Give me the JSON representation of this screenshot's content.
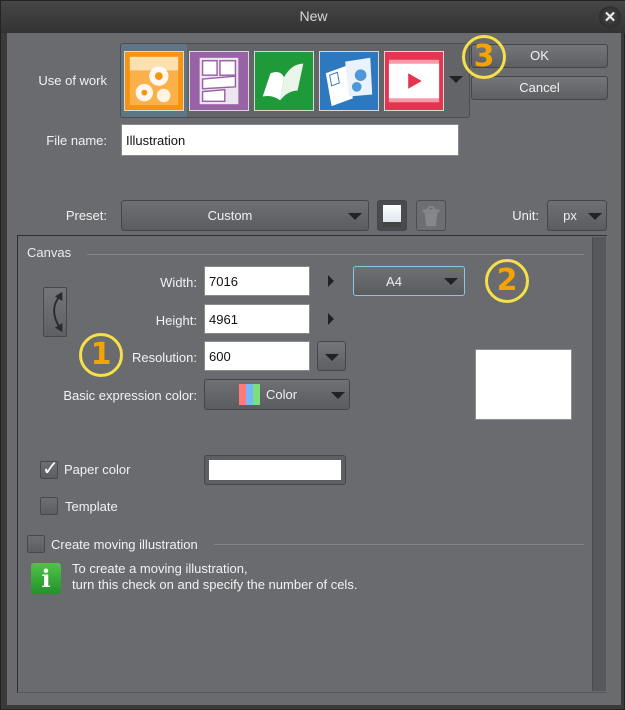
{
  "window": {
    "title": "New",
    "close_icon": "close-icon"
  },
  "use_of_work": {
    "label": "Use of work",
    "options": [
      {
        "name": "Illustration",
        "icon": "illustration-icon",
        "color": "#f7930f",
        "selected": true
      },
      {
        "name": "Comic",
        "icon": "comic-icon",
        "color": "#9a62a6",
        "selected": false
      },
      {
        "name": "Book",
        "icon": "book-icon",
        "color": "#1f9a3a",
        "selected": false
      },
      {
        "name": "Show all comic settings",
        "icon": "comic-settings-icon",
        "color": "#2e78c0",
        "selected": false
      },
      {
        "name": "Animation",
        "icon": "animation-icon",
        "color": "#e6334f",
        "selected": false
      }
    ],
    "more_icon": "chevron-down-icon"
  },
  "buttons": {
    "ok": "OK",
    "cancel": "Cancel"
  },
  "file_name": {
    "label": "File name:",
    "value": "Illustration"
  },
  "preset": {
    "label": "Preset:",
    "value": "Custom",
    "register_icon": "register-preset-icon",
    "delete_icon": "trash-icon"
  },
  "unit": {
    "label": "Unit:",
    "value": "px"
  },
  "canvas": {
    "section_label": "Canvas",
    "width_label": "Width:",
    "width_value": "7016",
    "height_label": "Height:",
    "height_value": "4961",
    "resolution_label": "Resolution:",
    "resolution_value": "600",
    "size_preset": "A4",
    "basic_color_label": "Basic expression color:",
    "basic_color_value": "Color",
    "paper_color_label": "Paper color",
    "paper_color_checked": true,
    "paper_color_value": "#ffffff",
    "template_label": "Template",
    "template_checked": false
  },
  "moving": {
    "label": "Create moving illustration",
    "checked": false,
    "info_line1": "To create a moving illustration,",
    "info_line2": "turn this check on and specify the number of cels."
  },
  "annotations": {
    "badge1": "1",
    "badge2": "2",
    "badge3": "3",
    "badge_ring_color": "#f5e04a",
    "badge_number_color": "#f4a400"
  }
}
